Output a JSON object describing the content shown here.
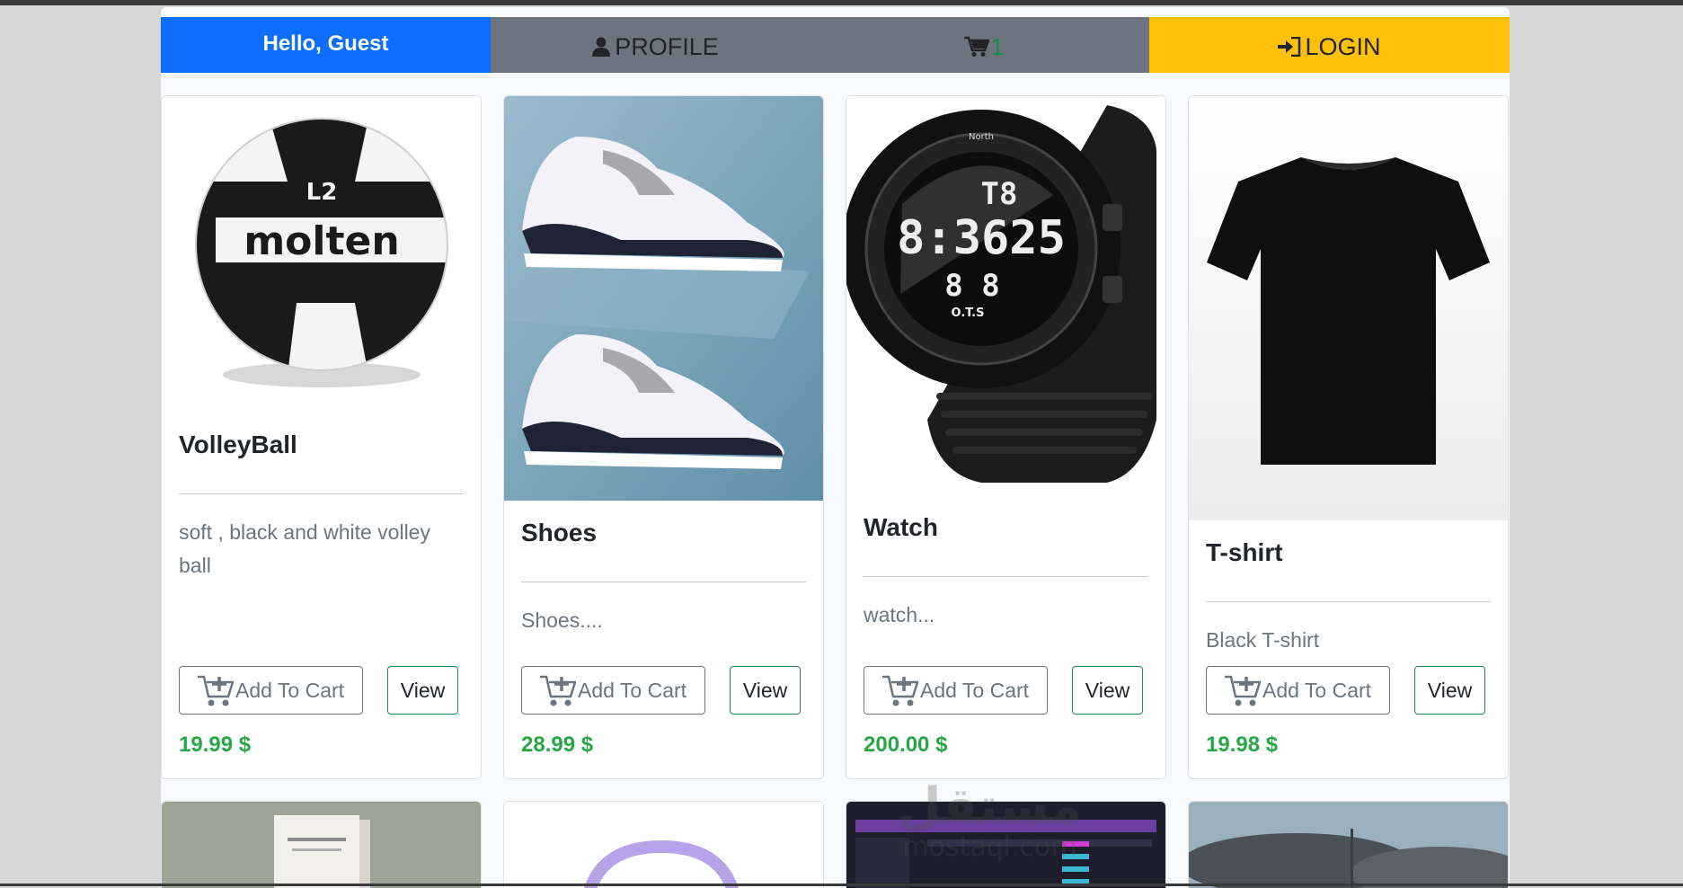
{
  "nav": {
    "greeting": "Hello, Guest",
    "profile_label": "PROFILE",
    "cart_count": "1",
    "login_label": "LOGIN"
  },
  "products": [
    {
      "title": "VolleyBall",
      "description": "soft , black and white volley ball",
      "add_label": "Add To Cart",
      "view_label": "View",
      "price": "19.99 $"
    },
    {
      "title": "Shoes",
      "description": "Shoes....",
      "add_label": "Add To Cart",
      "view_label": "View",
      "price": "28.99 $"
    },
    {
      "title": "Watch",
      "description": "watch...",
      "add_label": "Add To Cart",
      "view_label": "View",
      "price": "200.00 $"
    },
    {
      "title": "T-shirt",
      "description": "Black T-shirt",
      "add_label": "Add To Cart",
      "view_label": "View",
      "price": "19.98 $"
    }
  ],
  "watermark": {
    "logo": "مستقل",
    "site": "mostaql.com"
  },
  "colors": {
    "primary": "#0d6efd",
    "secondary": "#6c757d",
    "warning": "#ffc107",
    "success": "#198754",
    "price": "#28a745"
  }
}
